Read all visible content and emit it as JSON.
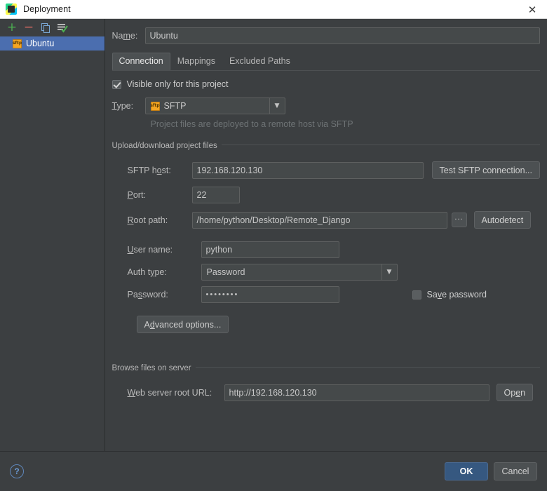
{
  "window": {
    "title": "Deployment",
    "icon": "pycharm-icon",
    "close_label": "✕"
  },
  "sidebar": {
    "toolbar": [
      {
        "name": "add-server-button",
        "glyph": "+"
      },
      {
        "name": "remove-server-button",
        "glyph": "−"
      },
      {
        "name": "copy-server-button",
        "glyph": "copy-icon"
      },
      {
        "name": "set-default-button",
        "glyph": "set-default-icon"
      }
    ],
    "items": [
      {
        "label": "Ubuntu",
        "icon": "sftp-icon",
        "badge": "sftp",
        "selected": true
      }
    ]
  },
  "form": {
    "name_label": "Name:",
    "name_value": "Ubuntu",
    "tabs": [
      {
        "label": "Connection",
        "active": true
      },
      {
        "label": "Mappings",
        "active": false
      },
      {
        "label": "Excluded Paths",
        "active": false
      }
    ],
    "visible_only_label": "Visible only for this project",
    "visible_only_checked": true,
    "type_label": "Type:",
    "type_value": "SFTP",
    "type_hint": "Project files are deployed to a remote host via SFTP",
    "upload_group_title": "Upload/download project files",
    "sftp_host_label": "SFTP host:",
    "sftp_host_value": "192.168.120.130",
    "test_connection_label": "Test SFTP connection...",
    "port_label": "Port:",
    "port_value": "22",
    "root_path_label": "Root path:",
    "root_path_value": "/home/python/Desktop/Remote_Django",
    "browse_button_label": "...",
    "autodetect_label": "Autodetect",
    "user_name_label": "User name:",
    "user_name_value": "python",
    "auth_type_label": "Auth type:",
    "auth_type_value": "Password",
    "password_label": "Password:",
    "password_value": "••••••••",
    "save_password_label": "Save password",
    "save_password_checked": false,
    "advanced_options_label": "Advanced options...",
    "browse_group_title": "Browse files on server",
    "web_url_label": "Web server root URL:",
    "web_url_value": "http://192.168.120.130",
    "open_label": "Open"
  },
  "footer": {
    "help_label": "?",
    "ok_label": "OK",
    "cancel_label": "Cancel"
  },
  "colors": {
    "window_bg": "#3c3f41",
    "selection": "#4b6eaf",
    "accent_ok": "#365880",
    "field_bg": "#45494a",
    "add_icon": "#4caf50",
    "remove_icon": "#d96a63"
  }
}
